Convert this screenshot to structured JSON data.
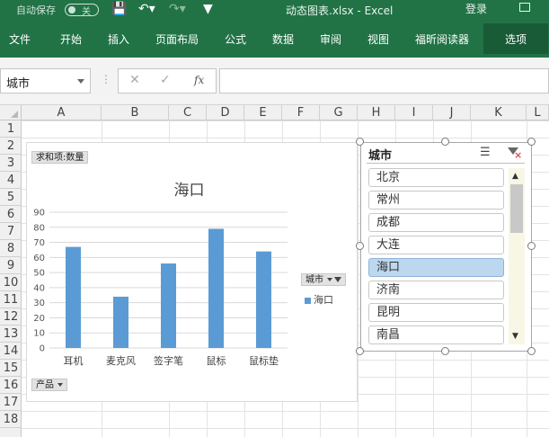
{
  "titlebar": {
    "autosave_label": "自动保存",
    "autosave_state": "关",
    "document_title": "动态图表.xlsx  -  Excel",
    "login_label": "登录"
  },
  "ribbon": {
    "tabs": [
      "文件",
      "开始",
      "插入",
      "页面布局",
      "公式",
      "数据",
      "审阅",
      "视图",
      "福昕阅读器",
      "选项"
    ],
    "active_tab": "选项"
  },
  "formula_bar": {
    "name_box_value": "城市",
    "formula_value": ""
  },
  "grid": {
    "columns": [
      "A",
      "B",
      "C",
      "D",
      "E",
      "F",
      "G",
      "H",
      "I",
      "J",
      "K",
      "L"
    ],
    "rows": [
      "1",
      "2",
      "3",
      "4",
      "5",
      "6",
      "7",
      "8",
      "9",
      "10",
      "11",
      "12",
      "13",
      "14",
      "15",
      "16",
      "17",
      "18"
    ]
  },
  "pivot_chart": {
    "values_field_button": "求和项:数量",
    "axis_field_button": "产品",
    "legend_field_button": "城市",
    "colors": {
      "bar": "#5b9bd5"
    }
  },
  "chart_data": {
    "type": "bar",
    "title": "海口",
    "categories": [
      "耳机",
      "麦克风",
      "签字笔",
      "鼠标",
      "鼠标垫"
    ],
    "series": [
      {
        "name": "海口",
        "values": [
          67,
          34,
          56,
          79,
          64
        ]
      }
    ],
    "yticks": [
      "0",
      "10",
      "20",
      "30",
      "40",
      "50",
      "60",
      "70",
      "80",
      "90"
    ],
    "ylim": [
      0,
      90
    ],
    "grid": true,
    "legend_position": "right",
    "xlabel": "",
    "ylabel": ""
  },
  "slicer": {
    "title": "城市",
    "items": [
      "北京",
      "常州",
      "成都",
      "大连",
      "海口",
      "济南",
      "昆明",
      "南昌"
    ],
    "selected": "海口"
  }
}
